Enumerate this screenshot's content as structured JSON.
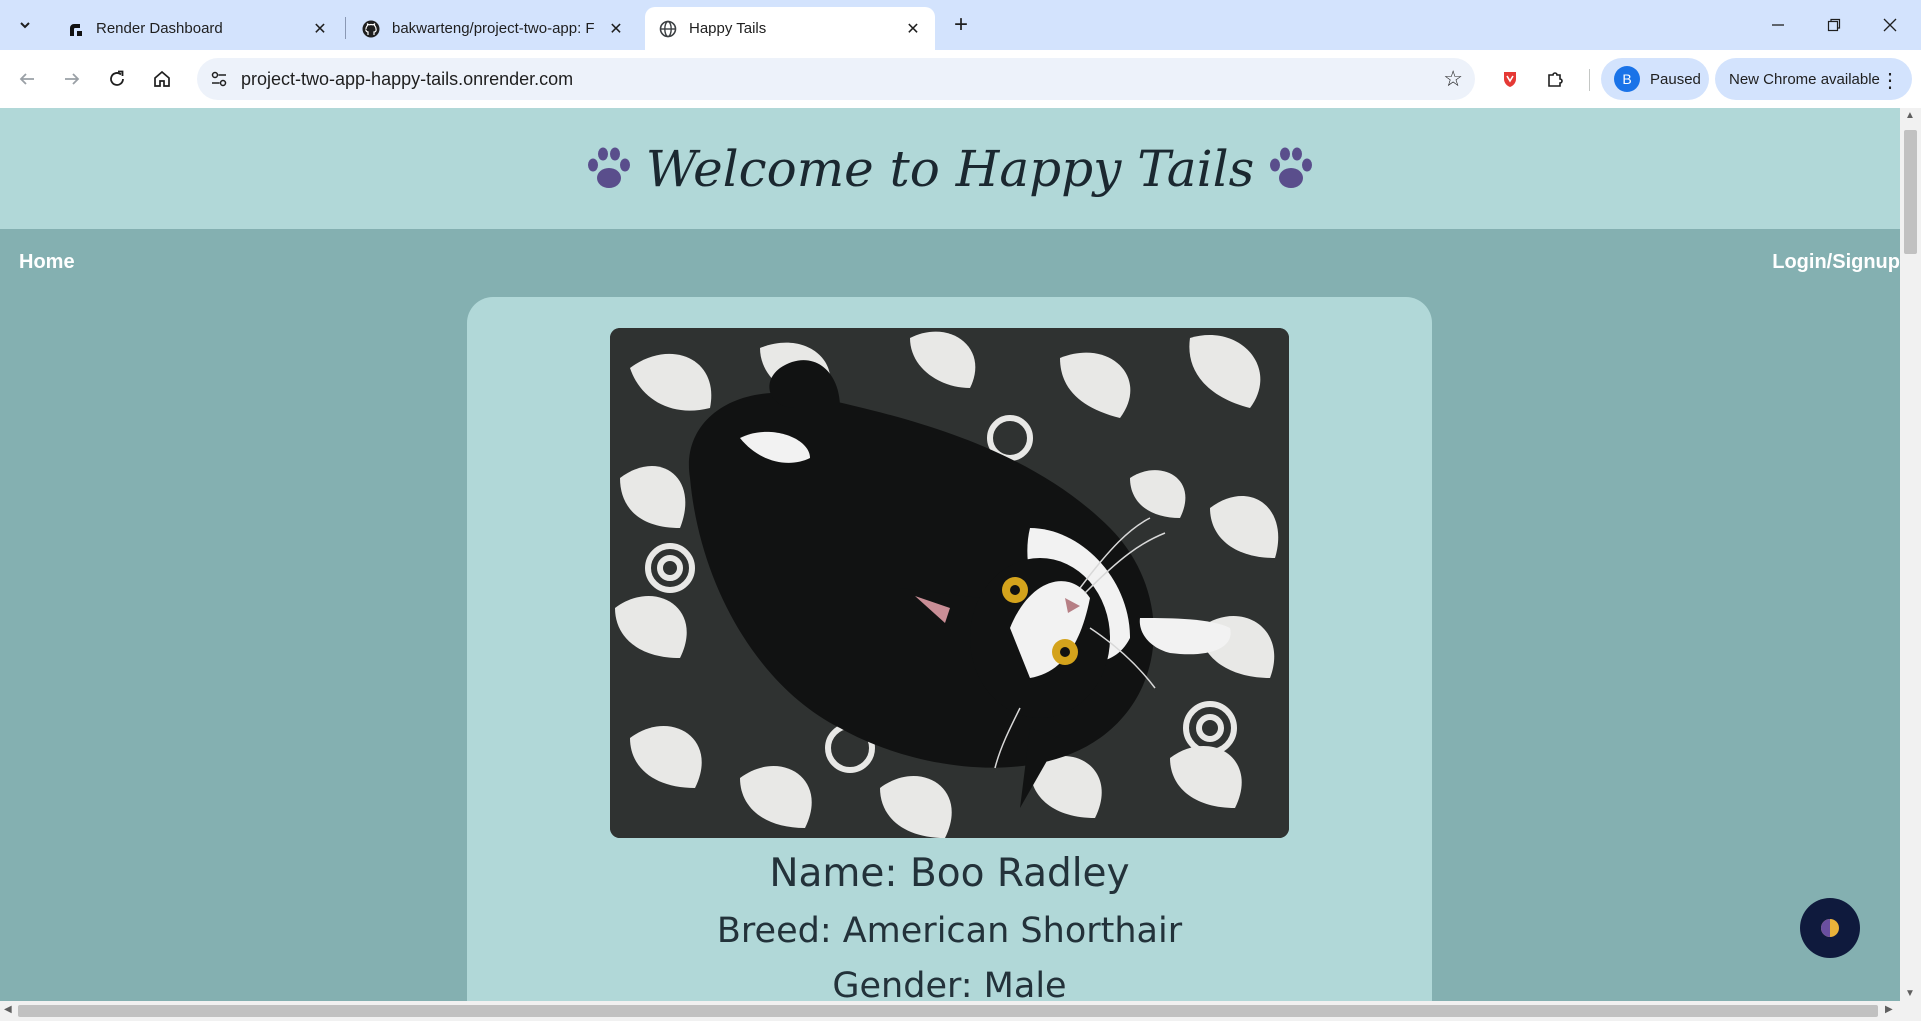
{
  "browser": {
    "tabs": [
      {
        "title": "Render Dashboard",
        "icon": "render-icon",
        "active": false
      },
      {
        "title": "bakwarteng/project-two-app: F",
        "icon": "github-icon",
        "active": false
      },
      {
        "title": "Happy Tails",
        "icon": "globe-icon",
        "active": true
      }
    ],
    "url": "project-two-app-happy-tails.onrender.com",
    "profile_initial": "B",
    "profile_status": "Paused",
    "update_label": "New Chrome available"
  },
  "site": {
    "title": "Welcome to Happy Tails",
    "nav": {
      "home": "Home",
      "login": "Login/Signup"
    }
  },
  "pet": {
    "name_line": "Name: Boo Radley",
    "breed_line": "Breed: American Shorthair",
    "gender_line": "Gender: Male",
    "photo": "black-and-white-cat-on-floral-blanket"
  },
  "colors": {
    "header_bg": "#b1d8d8",
    "page_bg": "#84b0b1",
    "card_bg": "#b1d8d8",
    "paw": "#5a4e8c",
    "text_dark": "#23323a"
  }
}
